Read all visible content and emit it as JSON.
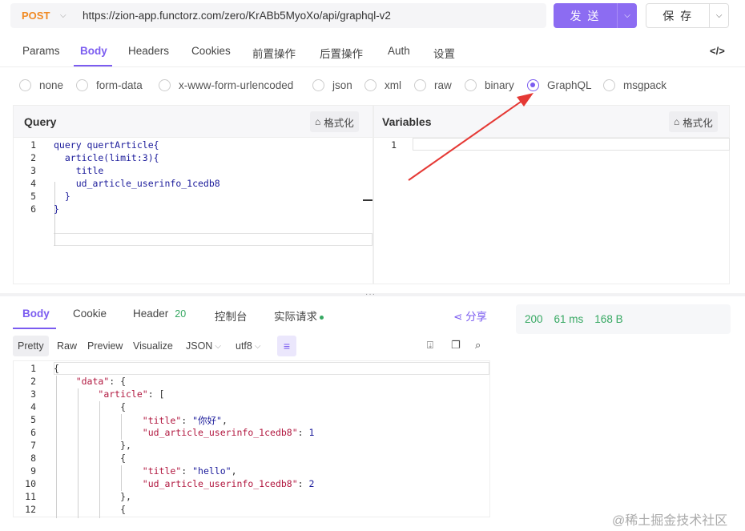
{
  "request": {
    "method": "POST",
    "url": "https://zion-app.functorz.com/zero/KrABb5MyoXo/api/graphql-v2",
    "send_label": "发 送",
    "save_label": "保 存"
  },
  "tabs": [
    "Params",
    "Body",
    "Headers",
    "Cookies",
    "前置操作",
    "后置操作",
    "Auth",
    "设置"
  ],
  "body_types": [
    "none",
    "form-data",
    "x-www-form-urlencoded",
    "json",
    "xml",
    "raw",
    "binary",
    "GraphQL",
    "msgpack"
  ],
  "selected_body_type": "GraphQL",
  "query_pane": {
    "title": "Query",
    "format_label": "格式化",
    "lines": [
      "query quertArticle{",
      "  article(limit:3){",
      "    title",
      "    ud_article_userinfo_1cedb8",
      "  }",
      "}"
    ]
  },
  "variables_pane": {
    "title": "Variables",
    "format_label": "格式化",
    "lines": [
      ""
    ]
  },
  "response_tabs": {
    "body": "Body",
    "cookie": "Cookie",
    "header": "Header",
    "header_count": "20",
    "console": "控制台",
    "actual_request": "实际请求",
    "share": "分享"
  },
  "view_modes": [
    "Pretty",
    "Raw",
    "Preview",
    "Visualize"
  ],
  "format_select": "JSON",
  "encoding_select": "utf8",
  "status": {
    "code": "200",
    "time": "61 ms",
    "size": "168 B"
  },
  "response_lines": [
    "{",
    "    \"data\": {",
    "        \"article\": [",
    "            {",
    "                \"title\": \"你好\",",
    "                \"ud_article_userinfo_1cedb8\": 1",
    "            },",
    "            {",
    "                \"title\": \"hello\",",
    "                \"ud_article_userinfo_1cedb8\": 2",
    "            },",
    "            {"
  ],
  "watermark": "@稀土掘金技术社区",
  "colors": {
    "accent": "#7b5cf0",
    "method": "#f08a24",
    "success": "#36a862",
    "annotation_arrow": "#e53935"
  }
}
